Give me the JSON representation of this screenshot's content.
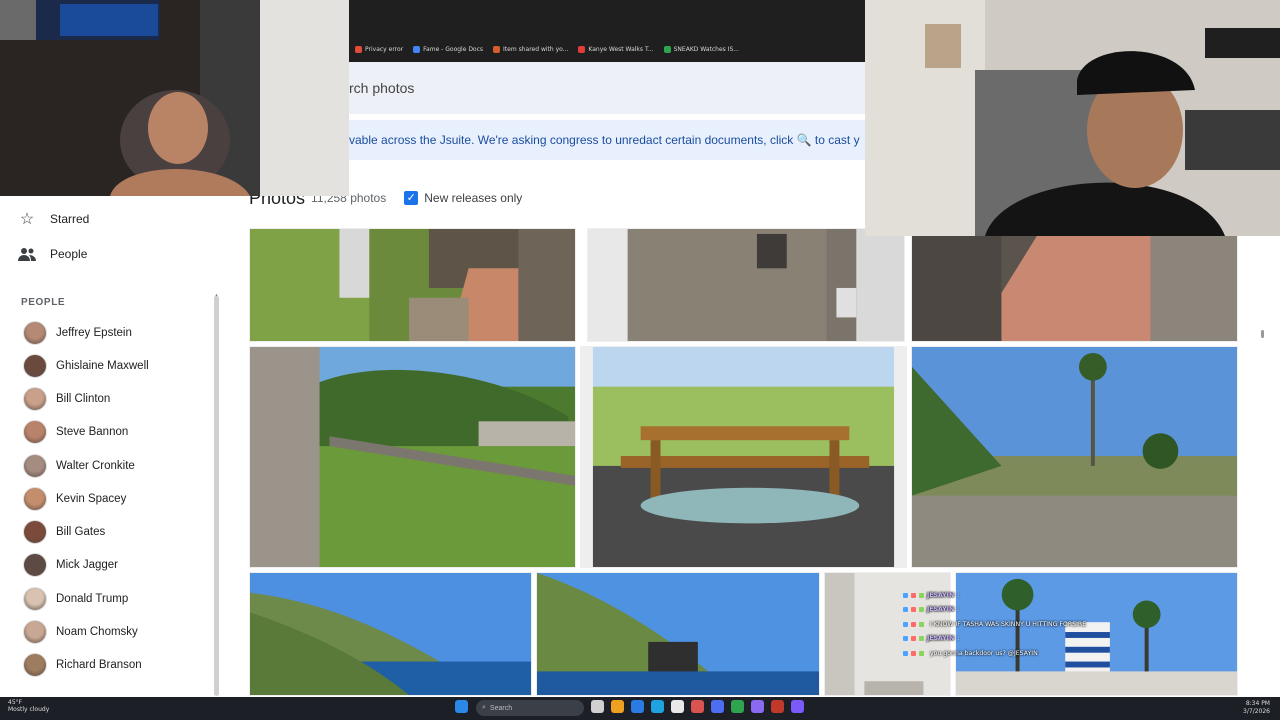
{
  "browser": {
    "bookmarks": [
      {
        "label": "Privacy error",
        "color": "#e04b3a"
      },
      {
        "label": "Fame - Google Docs",
        "color": "#4285f4"
      },
      {
        "label": "Item shared with yo...",
        "color": "#d65c2b"
      },
      {
        "label": "Kanye West Walks T...",
        "color": "#e23b3b"
      },
      {
        "label": "SNEAKD Watches IS...",
        "color": "#2ea44f"
      }
    ]
  },
  "search": {
    "placeholder": "rch photos"
  },
  "notice": {
    "text": "vable across the Jsuite. We're asking congress to unredact certain documents, click 🔍 to cast y"
  },
  "photos_header": {
    "title": "Photos",
    "count": "11,258 photos",
    "checkbox_label": "New releases only",
    "checked": true
  },
  "sidebar": {
    "nav": [
      {
        "label": "Starred",
        "icon": "star-icon"
      },
      {
        "label": "People",
        "icon": "people-icon"
      }
    ],
    "section_title": "PEOPLE",
    "people": [
      {
        "name": "Jeffrey Epstein",
        "color": "#b48a74"
      },
      {
        "name": "Ghislaine Maxwell",
        "color": "#6b4a3e"
      },
      {
        "name": "Bill Clinton",
        "color": "#c9a08a"
      },
      {
        "name": "Steve Bannon",
        "color": "#b8836a"
      },
      {
        "name": "Walter Cronkite",
        "color": "#a58c80"
      },
      {
        "name": "Kevin Spacey",
        "color": "#c48e6d"
      },
      {
        "name": "Bill Gates",
        "color": "#7c4a3a"
      },
      {
        "name": "Mick Jagger",
        "color": "#5d4a44"
      },
      {
        "name": "Donald Trump",
        "color": "#d9c3b0"
      },
      {
        "name": "Noam Chomsky",
        "color": "#c8a894"
      },
      {
        "name": "Richard Branson",
        "color": "#9e7c5f"
      }
    ]
  },
  "chat": [
    {
      "user": "JESAYIN",
      "text": ":"
    },
    {
      "user": "JESAYIN",
      "text": ":"
    },
    {
      "user": "",
      "text": "I KNOW IF TASHA WAS SKINNY U HITTING FORSIRE"
    },
    {
      "user": "JESAYIN",
      "text": ":"
    },
    {
      "user": "",
      "text": "you gonna backdoor us? @JESAYIN"
    }
  ],
  "taskbar": {
    "weather_temp": "45°F",
    "weather_desc": "Mostly cloudy",
    "search_label": "Search",
    "time": "8:34 PM",
    "date": "3/7/2026"
  }
}
